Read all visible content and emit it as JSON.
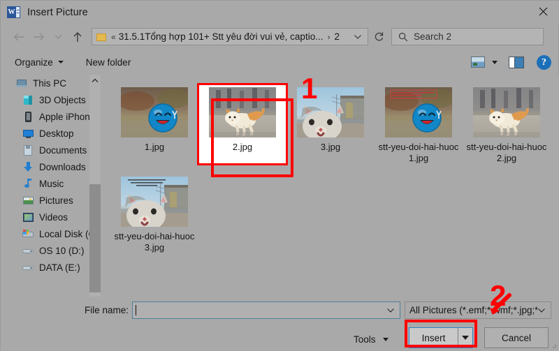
{
  "window": {
    "title": "Insert Picture",
    "app_icon": "word-icon",
    "close_label": "✕"
  },
  "nav": {
    "back_icon": "arrow-left-icon",
    "forward_icon": "arrow-right-icon",
    "recent_icon": "chevron-down-icon",
    "up_icon": "arrow-up-icon",
    "refresh_icon": "refresh-icon",
    "address": {
      "folder_icon": "folder-icon",
      "leading_chevron": "«",
      "crumb1": "31.5.1Tổng hợp 101+ Stt yêu đời vui vẻ, captio...",
      "separator": "›",
      "crumb2": "2",
      "dropdown_icon": "chevron-down-icon"
    },
    "search": {
      "icon": "search-icon",
      "placeholder": "Search 2"
    }
  },
  "toolbar": {
    "organize_label": "Organize",
    "organize_caret": "caret-down-icon",
    "new_folder_label": "New folder",
    "view_icon": "view-layout-icon",
    "view_caret": "caret-down-icon",
    "preview_pane_icon": "preview-pane-icon",
    "help_icon": "help-icon",
    "help_glyph": "?"
  },
  "sidebar": {
    "scroll_up_icon": "chevron-up-icon",
    "scroll_down_icon": "chevron-down-icon",
    "items": [
      {
        "label": "This PC",
        "icon": "pc-icon",
        "indent": 0
      },
      {
        "label": "3D Objects",
        "icon": "3d-objects-icon",
        "indent": 1
      },
      {
        "label": "Apple iPhone",
        "icon": "phone-icon",
        "indent": 1
      },
      {
        "label": "Desktop",
        "icon": "desktop-icon",
        "indent": 1
      },
      {
        "label": "Documents",
        "icon": "documents-icon",
        "indent": 1
      },
      {
        "label": "Downloads",
        "icon": "downloads-icon",
        "indent": 1
      },
      {
        "label": "Music",
        "icon": "music-icon",
        "indent": 1
      },
      {
        "label": "Pictures",
        "icon": "pictures-icon",
        "indent": 1
      },
      {
        "label": "Videos",
        "icon": "videos-icon",
        "indent": 1
      },
      {
        "label": "Local Disk (C:)",
        "icon": "local-disk-icon",
        "indent": 1
      },
      {
        "label": "OS 10 (D:)",
        "icon": "drive-icon",
        "indent": 1
      },
      {
        "label": "DATA (E:)",
        "icon": "drive-icon",
        "indent": 1
      }
    ]
  },
  "files": [
    {
      "name": "1.jpg",
      "thumb": "ball-blue-smiley",
      "selected": false
    },
    {
      "name": "2.jpg",
      "thumb": "cat-jumping",
      "selected": true
    },
    {
      "name": "3.jpg",
      "thumb": "cat-closeup-sky",
      "selected": false
    },
    {
      "name": "stt-yeu-doi-hai-huoc1.jpg",
      "thumb": "ball-blue-smiley-caption",
      "selected": false
    },
    {
      "name": "stt-yeu-doi-hai-huoc2.jpg",
      "thumb": "cat-jumping",
      "selected": false
    },
    {
      "name": "stt-yeu-doi-hai-huoc3.jpg",
      "thumb": "cat-closeup-caption",
      "selected": false
    }
  ],
  "bottom": {
    "filename_label": "File name:",
    "filename_value": "",
    "filename_dropdown_icon": "chevron-down-icon",
    "filter_value": "All Pictures (*.emf;*.wmf;*.jpg;*.j",
    "filter_dropdown_icon": "chevron-down-icon",
    "tools_label": "Tools",
    "tools_caret": "caret-down-icon",
    "insert_label": "Insert",
    "insert_caret": "caret-down-icon",
    "cancel_label": "Cancel"
  },
  "annotations": {
    "marker_1": "1",
    "marker_2": "2",
    "highlight_color": "#ff0000"
  }
}
